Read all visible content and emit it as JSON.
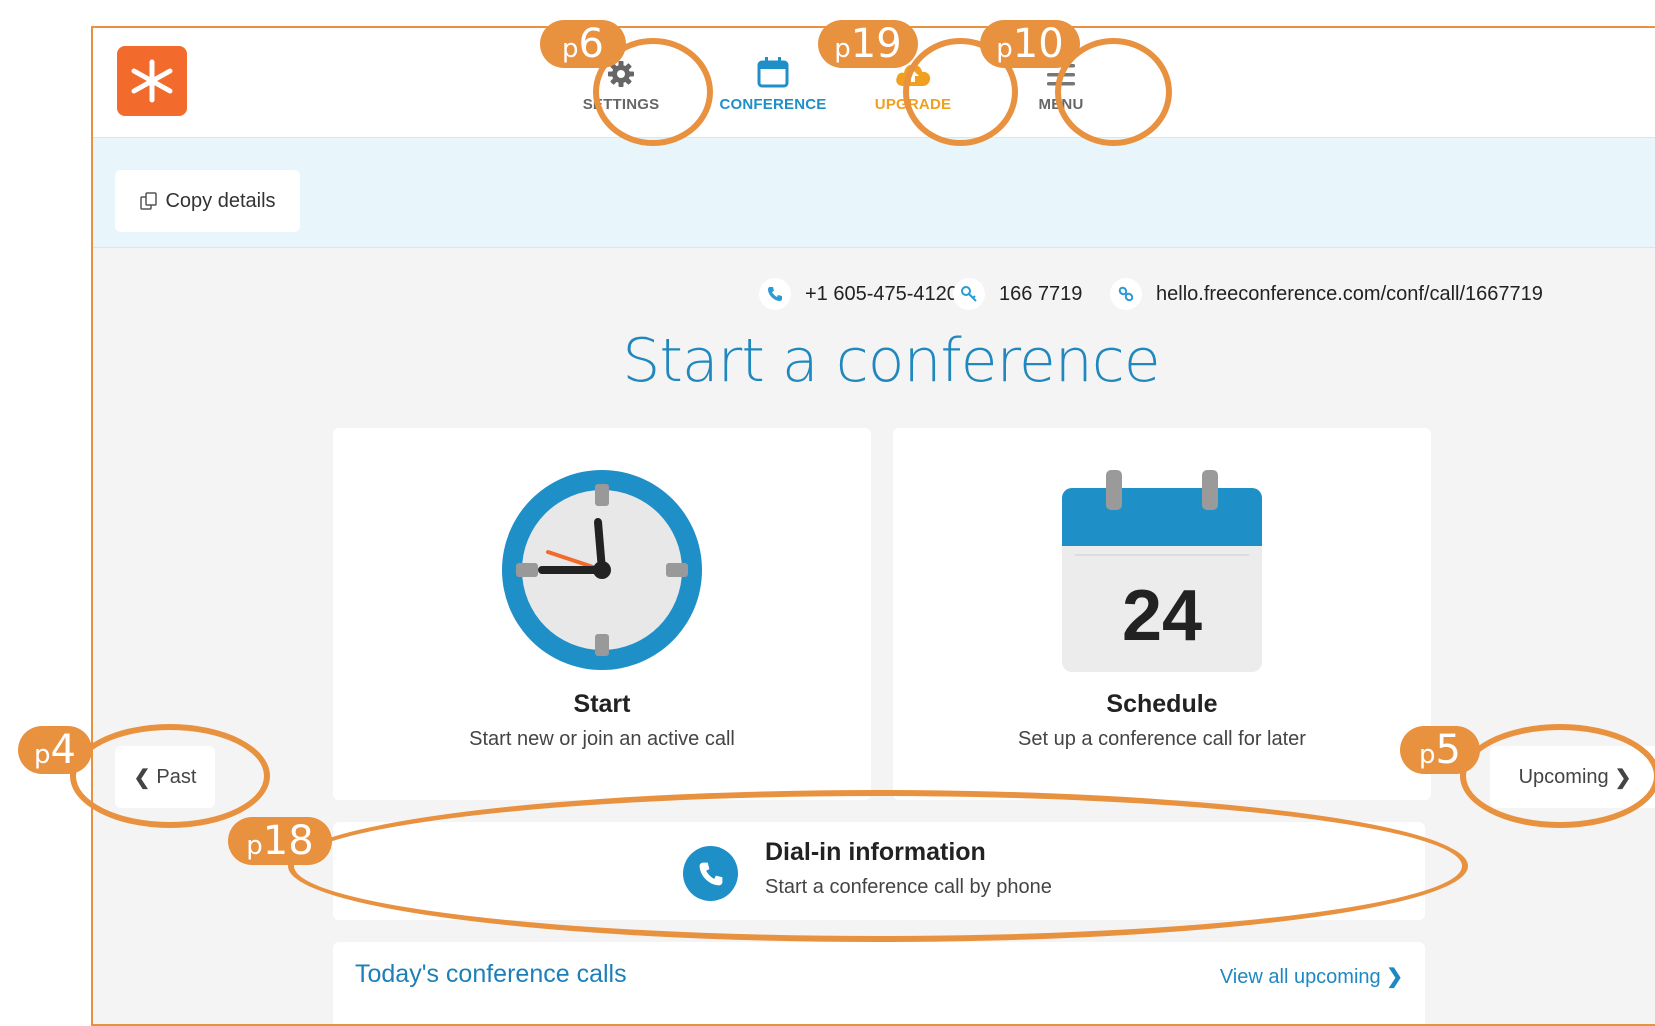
{
  "nav": {
    "settings": "SETTINGS",
    "conference": "CONFERENCE",
    "upgrade": "UPGRADE",
    "menu": "MENU"
  },
  "info": {
    "copy": "Copy details",
    "phone": "+1 605-475-4120",
    "access_code": "166 7719",
    "link": "hello.freeconference.com/conf/call/1667719"
  },
  "main": {
    "title": "Start a conference",
    "start": {
      "label": "Start",
      "desc": "Start new or join an active call"
    },
    "schedule": {
      "label": "Schedule",
      "desc": "Set up a conference call for later",
      "calendar_day": "24"
    },
    "past": "Past",
    "upcoming": "Upcoming",
    "dial": {
      "title": "Dial-in information",
      "desc": "Start a conference call by phone"
    },
    "today": {
      "title": "Today's conference calls",
      "link": "View all upcoming"
    }
  },
  "callouts": {
    "settings": {
      "p": "p",
      "n": "6"
    },
    "upgrade_a": {
      "p": "p",
      "n": "19"
    },
    "upgrade_b": {
      "p": "p",
      "n": "10"
    },
    "past": {
      "p": "p",
      "n": "4"
    },
    "upcoming": {
      "p": "p",
      "n": "5"
    },
    "dial": {
      "p": "p",
      "n": "18"
    }
  },
  "colors": {
    "accent": "#1f8fc8",
    "upgrade": "#f0a020",
    "logo": "#f26b2c",
    "annotation": "#e8913f"
  }
}
